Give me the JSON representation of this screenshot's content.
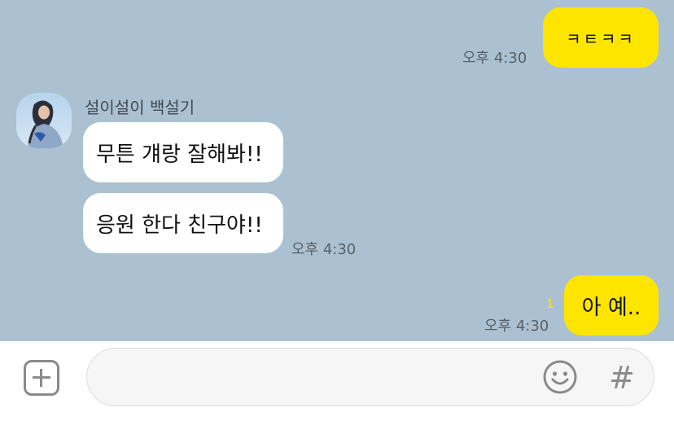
{
  "chat": {
    "messages": [
      {
        "text": "ㅋㅌㅋㅋ",
        "time": "오후 4:30"
      },
      {
        "sender": "설이설이 백설기",
        "text": "무튼 걔랑 잘해봐!!"
      },
      {
        "text": "응원 한다 친구야!!",
        "time": "오후 4:30"
      },
      {
        "text": "아 예..",
        "time": "오후 4:30",
        "unread": "1"
      }
    ]
  },
  "input": {
    "value": "",
    "placeholder": ""
  },
  "icons": {
    "add": "plus-square-icon",
    "emoji": "smiley-icon",
    "hash": "#"
  },
  "colors": {
    "chat_bg": "#abc1d1",
    "my_bubble": "#fee500",
    "their_bubble": "#ffffff",
    "unread": "#fee500"
  }
}
